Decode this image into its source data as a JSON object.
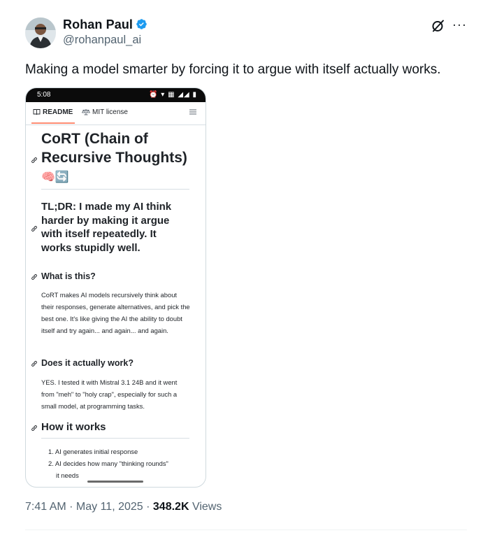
{
  "tweet": {
    "author_name": "Rohan Paul",
    "handle": "@rohanpaul_ai",
    "text": "Making a model smarter by forcing it to argue with itself actually works.",
    "verified_color": "#1d9bf0",
    "icons": [
      "grok-icon",
      "more-icon",
      "verified-badge-icon"
    ]
  },
  "media": {
    "status_time": "5:08",
    "status_icons": "⏰ ▾ ▦ ◢◢ ▮",
    "tabs": {
      "readme": "README",
      "license": "MIT license"
    },
    "readme": {
      "title_line1": "CoRT (Chain of",
      "title_line2": "Recursive Thoughts)",
      "title_emoji": "🧠🔄",
      "tldr": "TL;DR: I made my AI think harder by making it argue with itself repeatedly. It works stupidly well.",
      "section1_heading": "What is this?",
      "section1_text": "CoRT makes AI models recursively think about their responses, generate alternatives, and pick the best one. It's like giving the AI the ability to doubt itself and try again... and again... and again.",
      "section2_heading": "Does it actually work?",
      "section2_text": "YES. I tested it with Mistral 3.1 24B and it went from \"meh\" to \"holy crap\", especially for such a small model, at programming tasks.",
      "section3_heading": "How it works",
      "steps": [
        "1. AI generates initial response",
        "2. AI decides how many \"thinking rounds\"",
        "it needs"
      ]
    }
  },
  "footer": {
    "timestamp": "7:41 AM · May 11, 2025 · ",
    "views_count": "348.2K",
    "views_label": " Views"
  }
}
